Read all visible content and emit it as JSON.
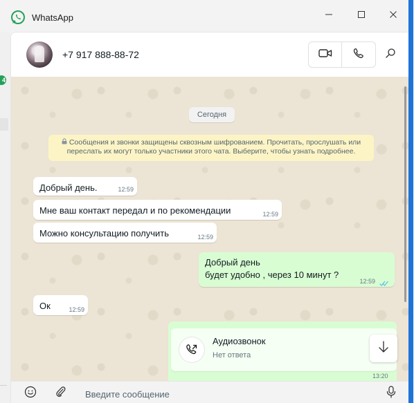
{
  "window": {
    "app_title": "WhatsApp",
    "controls": [
      "minimize",
      "maximize",
      "close"
    ]
  },
  "sidebar": {
    "unread_badge": "4"
  },
  "chat_header": {
    "contact_name": "+7 917 888-88-72",
    "icons": [
      "video-call-icon",
      "voice-call-icon",
      "search-icon"
    ]
  },
  "chat": {
    "date_label": "Сегодня",
    "encryption_notice": "Сообщения и звонки защищены сквозным шифрованием. Прочитать, прослушать или переслать их могут только участники этого чата. Выберите, чтобы узнать подробнее.",
    "messages": [
      {
        "direction": "in",
        "text": "Добрый день.",
        "time": "12:59"
      },
      {
        "direction": "in",
        "text": "Мне ваш контакт передал и по рекомендации",
        "time": "12:59"
      },
      {
        "direction": "in",
        "text": "Можно консультацию получить",
        "time": "12:59"
      },
      {
        "direction": "out",
        "lines": [
          "Добрый день",
          "будет удобно , через 10 минут ?"
        ],
        "time": "12:59",
        "status": "read"
      },
      {
        "direction": "in",
        "text": "Ок",
        "time": "12:59"
      }
    ],
    "call_card": {
      "title": "Аудиозвонок",
      "subtitle": "Нет ответа",
      "time": "13:20"
    }
  },
  "compose": {
    "placeholder": "Введите сообщение"
  },
  "colors": {
    "brand": "#25d366",
    "outgoing_bubble": "#d9fdd3",
    "read_ticks": "#53bdeb",
    "chat_background": "#ece4d4"
  }
}
